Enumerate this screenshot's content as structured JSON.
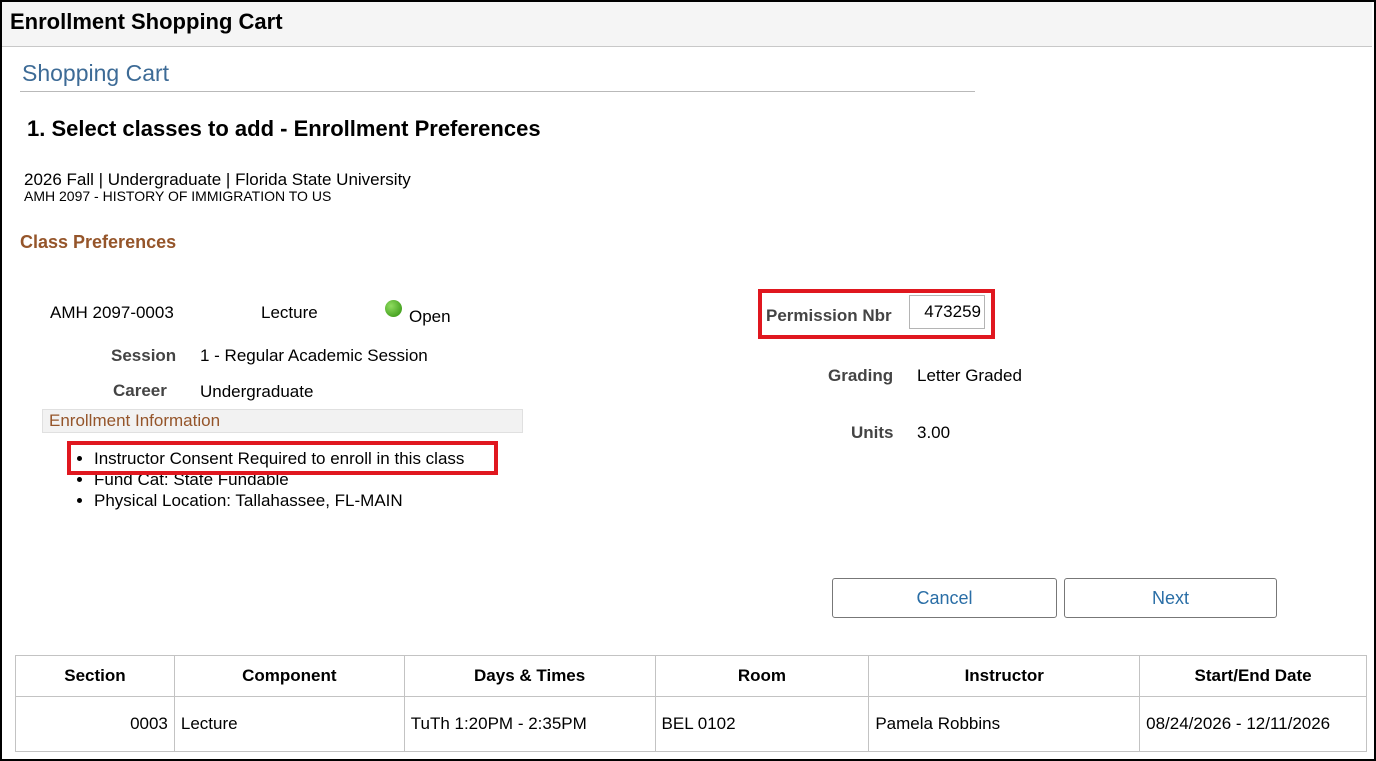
{
  "window": {
    "title": "Enrollment Shopping Cart"
  },
  "page": {
    "subtitle": "Shopping Cart",
    "step_heading": "1.  Select classes to add - Enrollment Preferences",
    "term_line": "2026 Fall | Undergraduate | Florida State University",
    "course_line": "AMH 2097 - HISTORY OF IMMIGRATION TO US"
  },
  "class_prefs": {
    "heading": "Class Preferences",
    "class_id": "AMH 2097-0003",
    "component": "Lecture",
    "status": "Open",
    "status_color": "#4aa524",
    "session_label": "Session",
    "session_value": "1 - Regular Academic Session",
    "career_label": "Career",
    "career_value": "Undergraduate",
    "enrollment_info_label": "Enrollment Information",
    "enrollment_info": [
      "Instructor Consent Required to enroll in this class",
      "Fund Cat: State Fundable",
      "Physical Location: Tallahassee, FL-MAIN"
    ],
    "permission_label": "Permission Nbr",
    "permission_value": "473259",
    "grading_label": "Grading",
    "grading_value": "Letter Graded",
    "units_label": "Units",
    "units_value": "3.00"
  },
  "buttons": {
    "cancel": "Cancel",
    "next": "Next"
  },
  "schedule_table": {
    "headers": [
      "Section",
      "Component",
      "Days & Times",
      "Room",
      "Instructor",
      "Start/End Date"
    ],
    "rows": [
      [
        "0003",
        "Lecture",
        "TuTh 1:20PM - 2:35PM",
        "BEL 0102",
        "Pamela Robbins",
        "08/24/2026 - 12/11/2026"
      ]
    ]
  },
  "colors": {
    "highlight": "#e0171f",
    "link_blue": "#2a6ea6",
    "heading_brown": "#95552a"
  }
}
